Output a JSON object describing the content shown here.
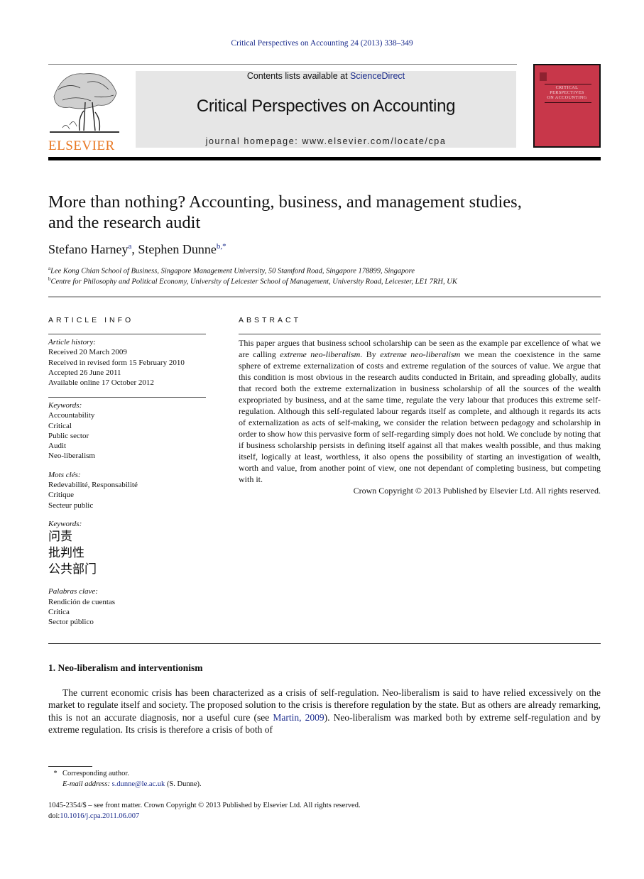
{
  "running_head": "Critical Perspectives on Accounting 24 (2013) 338–349",
  "header": {
    "publisher_logo_text": "ELSEVIER",
    "contents_prefix": "Contents lists available at ",
    "contents_link": "ScienceDirect",
    "journal_title": "Critical Perspectives on Accounting",
    "homepage": "journal homepage: www.elsevier.com/locate/cpa",
    "cover_title_lines": [
      "CRITICAL",
      "PERSPECTIVES",
      "ON ACCOUNTING"
    ],
    "colors": {
      "cover_red": "#c8374a",
      "elsevier_orange": "#e87722",
      "link_blue": "#1a2b8c",
      "banner_gray": "#e6e6e6"
    }
  },
  "article": {
    "title_line1": "More than nothing? Accounting, business, and management studies,",
    "title_line2": "and the research audit",
    "authors": [
      {
        "name": "Stefano Harney",
        "sup": "a"
      },
      {
        "name": "Stephen Dunne",
        "sup": "b,*"
      }
    ],
    "author_separator": ", ",
    "affiliations": [
      {
        "sup": "a",
        "text": "Lee Kong Chian School of Business, Singapore Management University, 50 Stamford Road, Singapore 178899, Singapore"
      },
      {
        "sup": "b",
        "text": "Centre for Philosophy and Political Economy, University of Leicester School of Management, University Road, Leicester, LE1 7RH, UK"
      }
    ]
  },
  "article_info": {
    "label": "ARTICLE INFO",
    "history_heading": "Article history:",
    "history": [
      "Received 20 March 2009",
      "Received in revised form 15 February 2010",
      "Accepted 26 June 2011",
      "Available online 17 October 2012"
    ],
    "keyword_groups": [
      {
        "heading": "Keywords:",
        "items": [
          "Accountability",
          "Critical",
          "Public sector",
          "Audit",
          "Neo-liberalism"
        ]
      },
      {
        "heading": "Mots clés:",
        "items": [
          "Redevabilité, Responsabilité",
          "Critique",
          "Secteur public"
        ]
      },
      {
        "heading": "Keywords:",
        "items": [
          "问责",
          "批判性",
          "公共部门"
        ],
        "cjk": true
      },
      {
        "heading": "Palabras clave:",
        "items": [
          "Rendición de cuentas",
          "Crítica",
          "Sector público"
        ]
      }
    ]
  },
  "abstract": {
    "label": "ABSTRACT",
    "p1": "This paper argues that business school scholarship can be seen as the example par excellence of what we are calling ",
    "em1": "extreme neo-liberalism",
    "p2": ". By ",
    "em2": "extreme neo-liberalism",
    "p3": " we mean the coexistence in the same sphere of extreme externalization of costs and extreme regulation of the sources of value. We argue that this condition is most obvious in the research audits conducted in Britain, and spreading globally, audits that record both the extreme externalization in business scholarship of all the sources of the wealth expropriated by business, and at the same time, regulate the very labour that produces this extreme self-regulation. Although this self-regulated labour regards itself as complete, and although it regards its acts of externalization as acts of self-making, we consider the relation between pedagogy and scholarship in order to show how this pervasive form of self-regarding simply does not hold. We conclude by noting that if business scholarship persists in defining itself against all that makes wealth possible, and thus making itself, logically at least, worthless, it also opens the possibility of starting an investigation of wealth, worth and value, from another point of view, one not dependant of completing business, but competing with it.",
    "copyright": "Crown Copyright © 2013 Published by Elsevier Ltd. All rights reserved."
  },
  "section1": {
    "heading": "1. Neo-liberalism and interventionism",
    "text_before": "The current economic crisis has been characterized as a crisis of self-regulation. Neo-liberalism is said to have relied excessively on the market to regulate itself and society. The proposed solution to the crisis is therefore regulation by the state. But as others are already remarking, this is not an accurate diagnosis, nor a useful cure (see ",
    "citation": "Martin, 2009",
    "text_after": "). Neo-liberalism was marked both by extreme self-regulation and by extreme regulation. Its crisis is therefore a crisis of both of"
  },
  "footnotes": {
    "star": "*",
    "corresponding": "Corresponding author.",
    "email_label": "E-mail address: ",
    "email": "s.dunne@le.ac.uk",
    "email_suffix": " (S. Dunne).",
    "front_matter": "1045-2354/$ – see front matter. Crown Copyright © 2013 Published by Elsevier Ltd. All rights reserved.",
    "doi_label": "doi:",
    "doi": "10.1016/j.cpa.2011.06.007"
  }
}
